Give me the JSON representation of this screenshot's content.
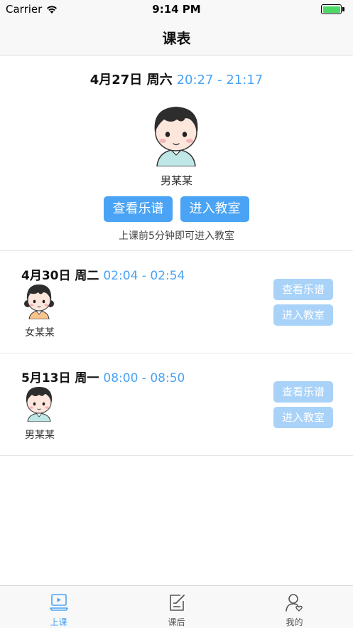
{
  "status_bar": {
    "carrier": "Carrier",
    "time": "9:14 PM",
    "battery_level": 1.0
  },
  "nav": {
    "title": "课表"
  },
  "featured": {
    "date": "4月27日 周六",
    "time_range": "20:27 - 21:17",
    "name": "男某某",
    "score_label": "查看乐谱",
    "enter_label": "进入教室",
    "hint": "上课前5分钟即可进入教室"
  },
  "lessons": [
    {
      "date": "4月30日 周二",
      "time_range": "02:04 - 02:54",
      "name": "女某某",
      "score_label": "查看乐谱",
      "enter_label": "进入教室"
    },
    {
      "date": "5月13日 周一",
      "time_range": "08:00 - 08:50",
      "name": "男某某",
      "score_label": "查看乐谱",
      "enter_label": "进入教室"
    }
  ],
  "tabs": [
    {
      "label": "上课",
      "icon": "class-screen-icon",
      "active": true
    },
    {
      "label": "课后",
      "icon": "edit-note-icon",
      "active": false
    },
    {
      "label": "我的",
      "icon": "profile-icon",
      "active": false
    }
  ],
  "colors": {
    "accent": "#4aa3f4",
    "accent_disabled": "#a9d2f8",
    "battery": "#4cd964"
  }
}
